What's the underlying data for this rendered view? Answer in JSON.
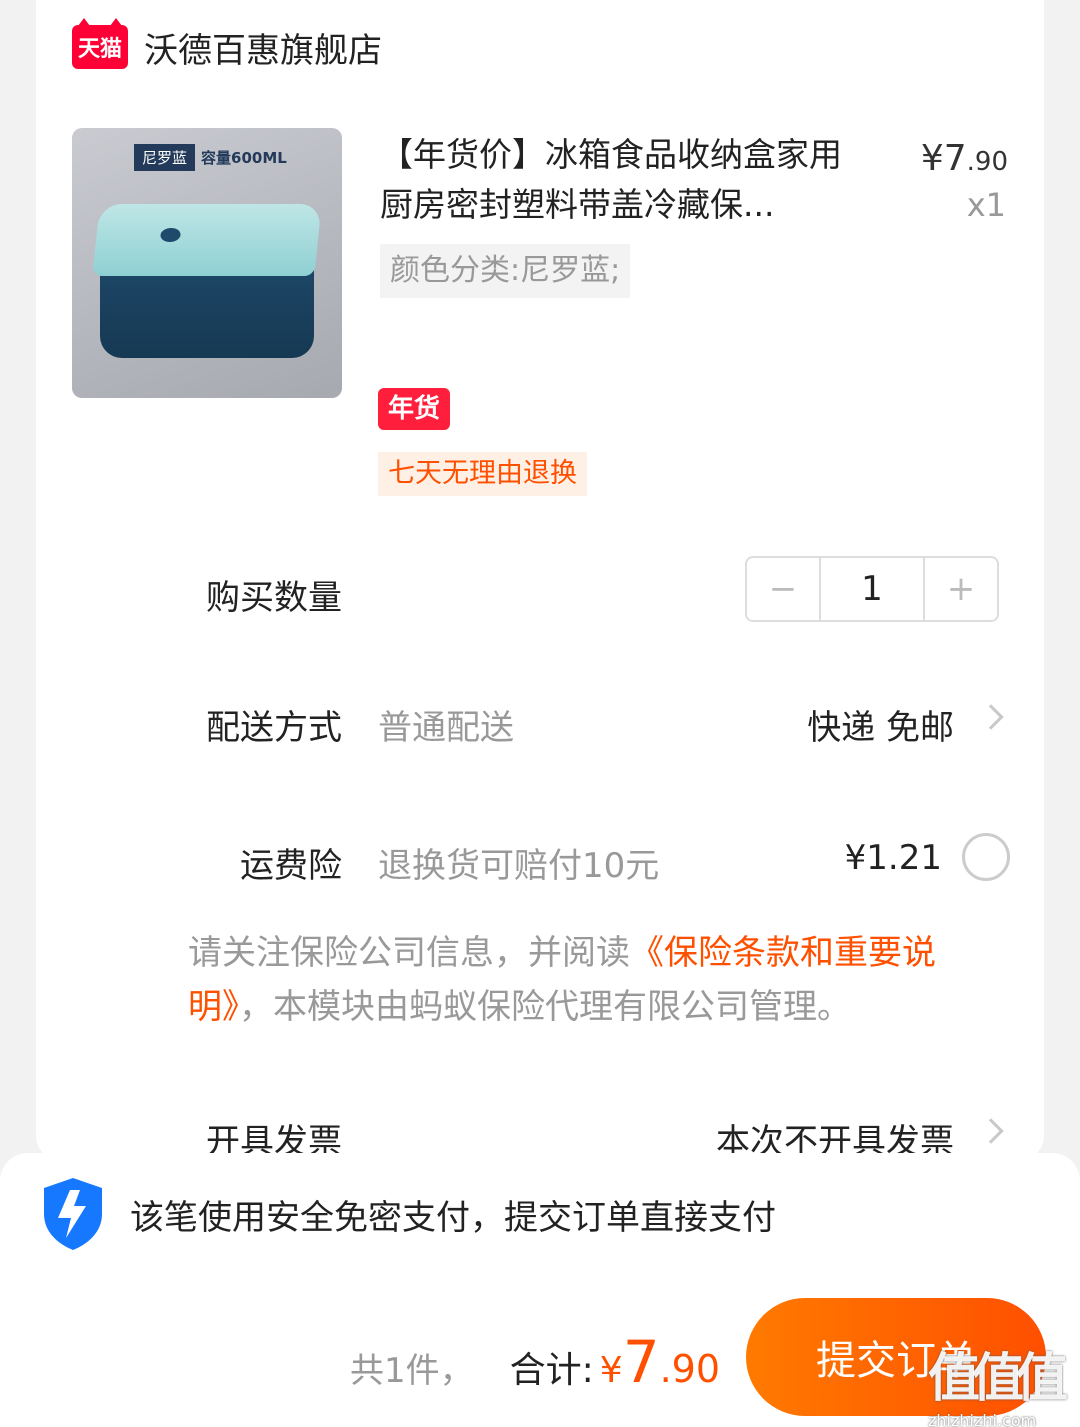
{
  "shop": {
    "badge": "天猫",
    "name": "沃德百惠旗舰店"
  },
  "product": {
    "image_color": "尼罗蓝",
    "image_capacity": "容量600ML",
    "title": "【年货价】冰箱食品收纳盒家用厨房密封塑料带盖冷藏保...",
    "price_symbol": "¥",
    "price_int": "7",
    "price_dec": ".90",
    "quantity_label": "x1",
    "sku": "颜色分类:尼罗蓝;",
    "badge_nianhuo": "年货",
    "badge_return": "七天无理由退换"
  },
  "quantity": {
    "label": "购买数量",
    "minus": "−",
    "value": "1",
    "plus": "+"
  },
  "shipping": {
    "label": "配送方式",
    "method": "普通配送",
    "value": "快递 免邮"
  },
  "insurance": {
    "label": "运费险",
    "desc": "退换货可赔付10元",
    "price": "¥1.21"
  },
  "notice": {
    "before": "请关注保险公司信息，并阅读",
    "link": "《保险条款和重要说明》",
    "after": "，本模块由蚂蚁保险代理有限公司管理。"
  },
  "invoice": {
    "label": "开具发票",
    "value": "本次不开具发票"
  },
  "security": {
    "text": "该笔使用安全免密支付，提交订单直接支付"
  },
  "footer": {
    "count": "共1件，",
    "total_label": "合计:",
    "total_symbol": "¥",
    "total_int": "7",
    "total_dec": ".90",
    "submit": "提交订单"
  },
  "watermark": {
    "glyph": "值值值",
    "url": "zhizhizhi.com"
  },
  "colors": {
    "accent": "#ff5000",
    "tmall": "#ff0036",
    "shield": "#1677ff"
  }
}
